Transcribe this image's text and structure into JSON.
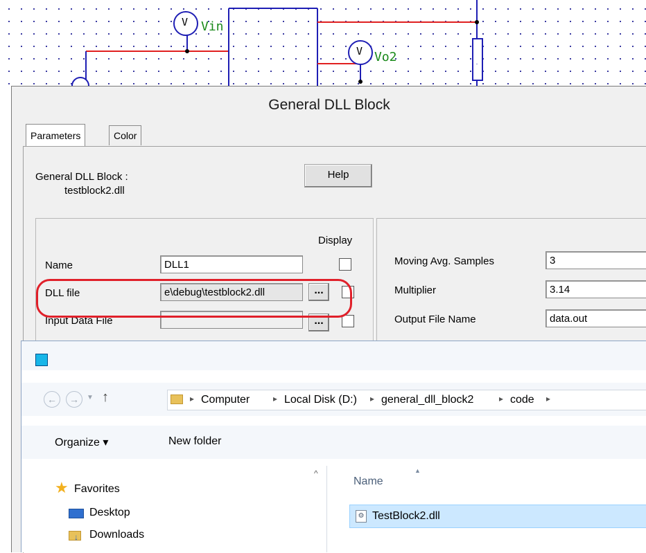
{
  "schematic": {
    "meters": [
      {
        "symbol": "V",
        "label": "Vin"
      },
      {
        "symbol": "V",
        "label": "Vo2"
      }
    ]
  },
  "dll_dialog": {
    "title": "General DLL Block",
    "tabs": [
      "Parameters",
      "Color"
    ],
    "block_heading": "General DLL Block :",
    "block_file": "testblock2.dll",
    "help_label": "Help",
    "display_header": "Display",
    "left_fields": [
      {
        "label": "Name",
        "value": "DLL1"
      },
      {
        "label": "DLL file",
        "value": "e\\debug\\testblock2.dll"
      },
      {
        "label": "Input Data File",
        "value": ""
      }
    ],
    "browse_label": "...",
    "right_fields": [
      {
        "label": "Moving Avg. Samples",
        "value": "3"
      },
      {
        "label": "Multiplier",
        "value": "3.14"
      },
      {
        "label": "Output File Name",
        "value": "data.out"
      }
    ],
    "highlight_color": "#e0202a"
  },
  "file_dialog": {
    "breadcrumb": [
      "Computer",
      "Local Disk (D:)",
      "general_dll_block2",
      "code"
    ],
    "organize_label": "Organize ▾",
    "new_folder_label": "New folder",
    "nav_items": [
      "Favorites",
      "Desktop",
      "Downloads"
    ],
    "column_header": "Name",
    "files": [
      {
        "name": "TestBlock2.dll",
        "selected": true
      }
    ]
  },
  "colors": {
    "wire_blue": "#1e1eb4",
    "wire_red": "#e02020",
    "label_green": "#1a8a1a",
    "selection": "#cce8ff"
  }
}
